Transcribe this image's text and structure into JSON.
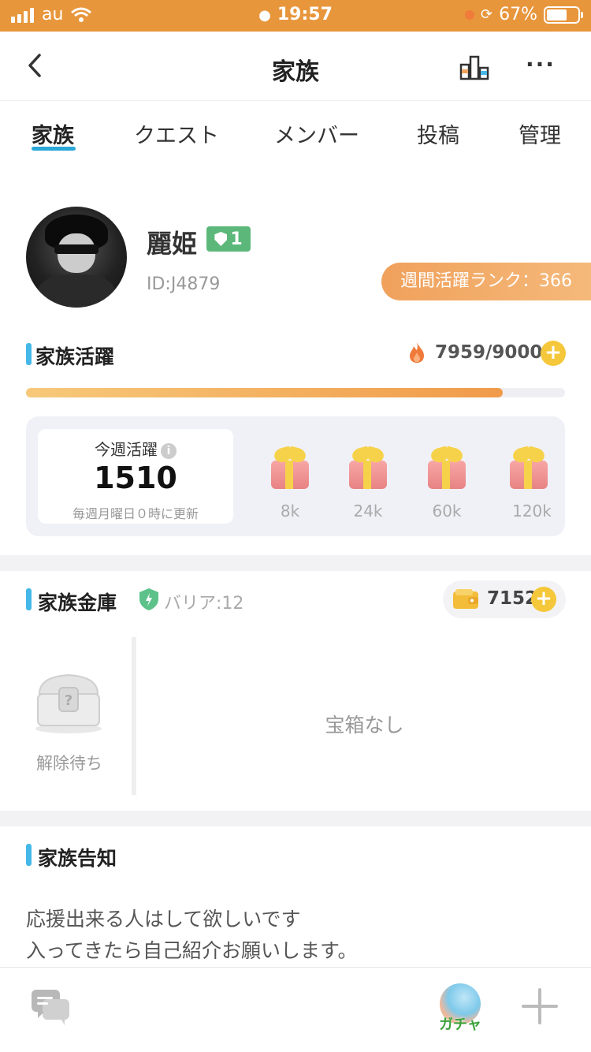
{
  "status_bar": {
    "carrier": "au",
    "time": "19:57",
    "battery": "67%"
  },
  "nav": {
    "title": "家族",
    "more_label": "···"
  },
  "tabs": [
    {
      "label": "家族",
      "active": true
    },
    {
      "label": "クエスト",
      "active": false
    },
    {
      "label": "メンバー",
      "active": false
    },
    {
      "label": "投稿",
      "active": false
    },
    {
      "label": "管理",
      "active": false
    }
  ],
  "profile": {
    "name": "麗姫",
    "level": "1",
    "id": "ID:J4879",
    "weekly_rank": "週間活躍ランク：366"
  },
  "activity": {
    "title": "家族活躍",
    "value": "7959/9000",
    "progress": 0.884,
    "weekly_label": "今週活躍",
    "weekly_value": "1510",
    "weekly_note": "毎週月曜日０時に更新",
    "rewards": [
      "8k",
      "24k",
      "60k",
      "120k"
    ]
  },
  "vault": {
    "title": "家族金庫",
    "barrier": "バリア:12",
    "coins": "7152",
    "chest_label": "解除待ち",
    "empty_text": "宝箱なし"
  },
  "notice": {
    "title": "家族告知",
    "text": "応援出来る人はして欲しいです\n入ってきたら自己紹介お願いします。"
  },
  "bottom": {
    "gacha_label": "ガチャ"
  },
  "colors": {
    "status_bar": "#e8963c",
    "accent_blue": "#44b8e8",
    "rank_pill": "#f0a15c",
    "level_green": "#5cb87a"
  }
}
